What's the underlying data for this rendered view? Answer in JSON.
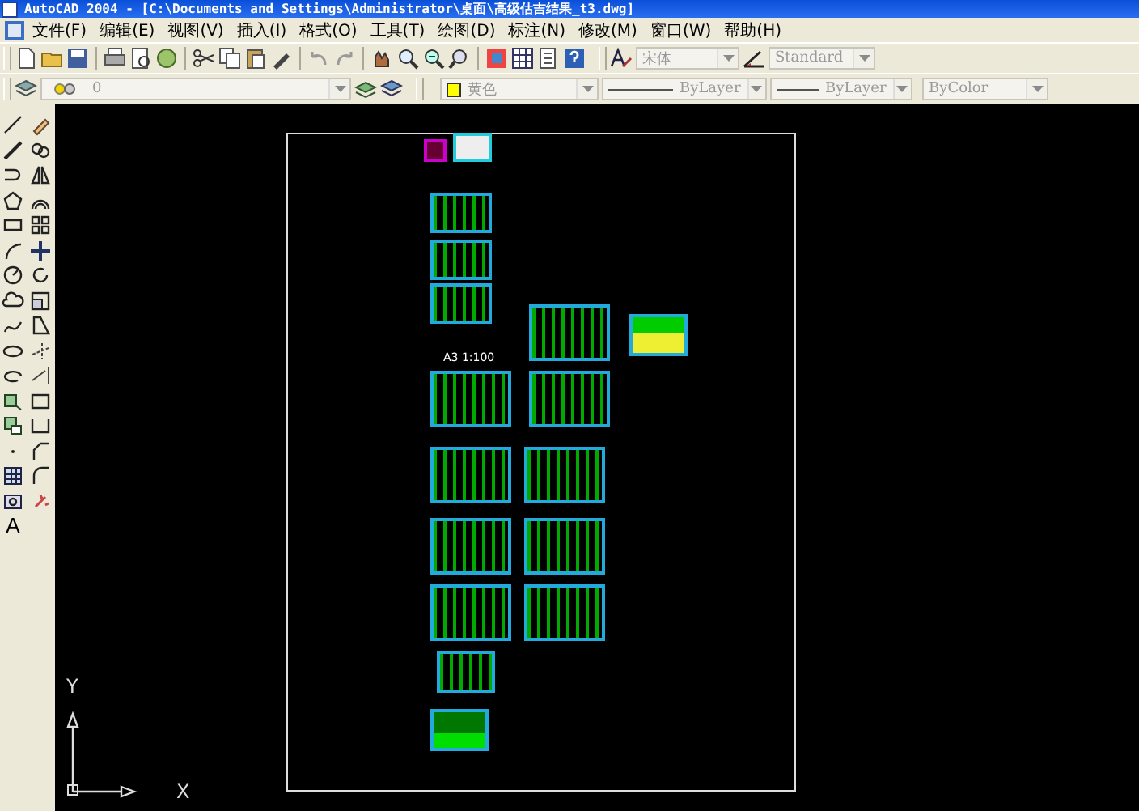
{
  "window": {
    "title": "AutoCAD 2004 - [C:\\Documents and Settings\\Administrator\\桌面\\高级估吉结果_t3.dwg]"
  },
  "menu": [
    "文件(F)",
    "编辑(E)",
    "视图(V)",
    "插入(I)",
    "格式(O)",
    "工具(T)",
    "绘图(D)",
    "标注(N)",
    "修改(M)",
    "窗口(W)",
    "帮助(H)"
  ],
  "styles_toolbar": {
    "text_style": "宋体",
    "dim_style": "Standard"
  },
  "properties_toolbar": {
    "layer": "0",
    "color_name": "黄色",
    "linetype": "ByLayer",
    "lineweight": "ByLayer",
    "plot_style": "ByColor"
  },
  "draw_toolbar": {
    "mtext_label": "A"
  },
  "canvas": {
    "scale_label": "A3 1:100",
    "ucs": {
      "x_label": "X",
      "y_label": "Y"
    }
  }
}
